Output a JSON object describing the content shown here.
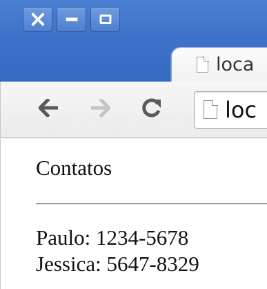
{
  "tab": {
    "title": "loca"
  },
  "omnibox": {
    "url_text": "loc"
  },
  "page": {
    "heading": "Contatos",
    "contacts": [
      {
        "text": "Paulo: 1234-5678"
      },
      {
        "text": "Jessica: 5647-8329"
      }
    ]
  },
  "icons": {
    "close": "close-icon",
    "minimize": "minimize-icon",
    "maximize": "maximize-icon",
    "back": "back-arrow-icon",
    "forward": "forward-arrow-icon",
    "reload": "reload-icon",
    "page": "page-icon"
  },
  "colors": {
    "frame": "#3f73c9",
    "toolbar": "#f1f1f1",
    "icon_active": "#5a5a5a",
    "icon_disabled": "#c4c4c4"
  }
}
